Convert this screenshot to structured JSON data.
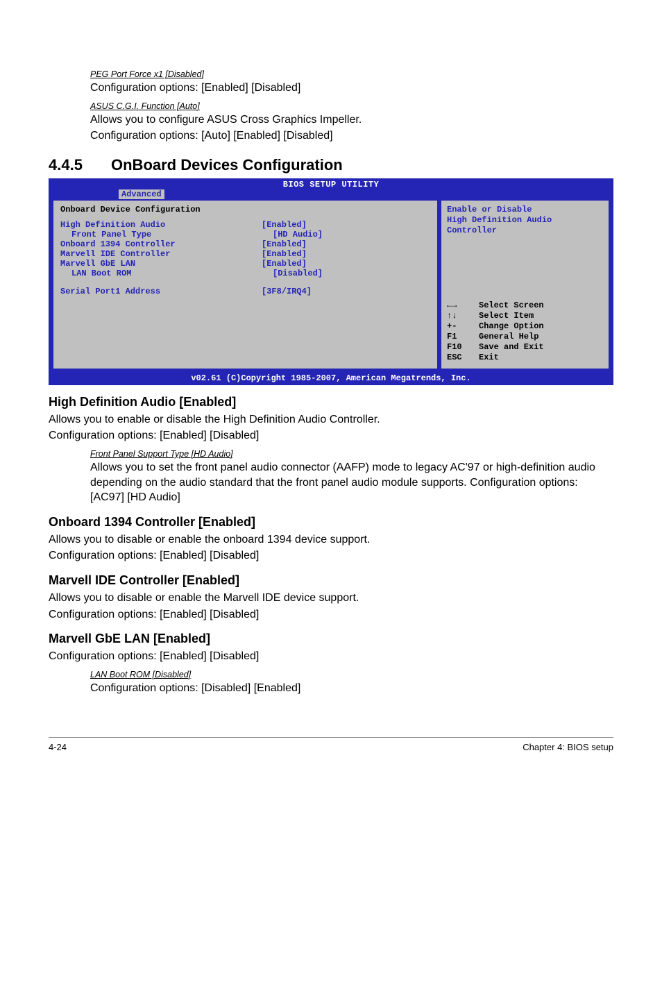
{
  "top": {
    "peg_label": "PEG Port Force x1 [Disabled]",
    "peg_desc": "Configuration options: [Enabled] [Disabled]",
    "asus_label": "ASUS C.G.I. Function [Auto]",
    "asus_line1": "Allows you to configure ASUS Cross Graphics Impeller.",
    "asus_line2": "Configuration options: [Auto] [Enabled] [Disabled]"
  },
  "section": {
    "num": "4.4.5",
    "title": "OnBoard Devices Configuration"
  },
  "bios": {
    "title": "BIOS SETUP UTILITY",
    "tab": "Advanced",
    "panel_heading": "Onboard Device Configuration",
    "items": [
      {
        "label": "High Definition Audio",
        "value": "[Enabled]",
        "sub": false
      },
      {
        "label": "Front Panel Type",
        "value": "[HD Audio]",
        "sub": true
      },
      {
        "label": "Onboard 1394 Controller",
        "value": "[Enabled]",
        "sub": false
      },
      {
        "label": "Marvell IDE Controller",
        "value": "[Enabled]",
        "sub": false
      },
      {
        "label": "Marvell GbE LAN",
        "value": "[Enabled]",
        "sub": false
      },
      {
        "label": "LAN Boot ROM",
        "value": "[Disabled]",
        "sub": true
      }
    ],
    "serial_label": "Serial Port1 Address",
    "serial_value": "[3F8/IRQ4]",
    "help_line1": "Enable or Disable",
    "help_line2": "High Definition Audio",
    "help_line3": "Controller",
    "keys": [
      {
        "k": "←→",
        "d": "Select Screen"
      },
      {
        "k": "↑↓",
        "d": "Select Item"
      },
      {
        "k": "+-",
        "d": "Change Option"
      },
      {
        "k": "F1",
        "d": "General Help"
      },
      {
        "k": "F10",
        "d": "Save and Exit"
      },
      {
        "k": "ESC",
        "d": "Exit"
      }
    ],
    "footer": "v02.61 (C)Copyright 1985-2007, American Megatrends, Inc."
  },
  "hda": {
    "heading": "High Definition Audio [Enabled]",
    "line1": "Allows you to enable or disable the High Definition Audio Controller.",
    "line2": "Configuration options: [Enabled] [Disabled]",
    "fp_label": "Front Panel Support Type [HD Audio]",
    "fp_desc": "Allows you to set the front panel audio connector (AAFP) mode to legacy AC'97 or high-definition audio depending on the audio standard that the front panel audio module supports. Configuration options: [AC97] [HD Audio]"
  },
  "o1394": {
    "heading": "Onboard 1394 Controller [Enabled]",
    "line1": "Allows you to disable or enable the onboard 1394 device support.",
    "line2": "Configuration options: [Enabled] [Disabled]"
  },
  "mide": {
    "heading": "Marvell IDE Controller [Enabled]",
    "line1": "Allows you to disable or enable the Marvell IDE device support.",
    "line2": "Configuration options: [Enabled] [Disabled]"
  },
  "mgbe": {
    "heading": "Marvell GbE LAN [Enabled]",
    "line1": "Configuration options: [Enabled] [Disabled]",
    "lan_label": "LAN Boot ROM [Disabled]",
    "lan_desc": "Configuration options: [Disabled] [Enabled]"
  },
  "footer": {
    "left": "4-24",
    "right": "Chapter 4: BIOS setup"
  }
}
